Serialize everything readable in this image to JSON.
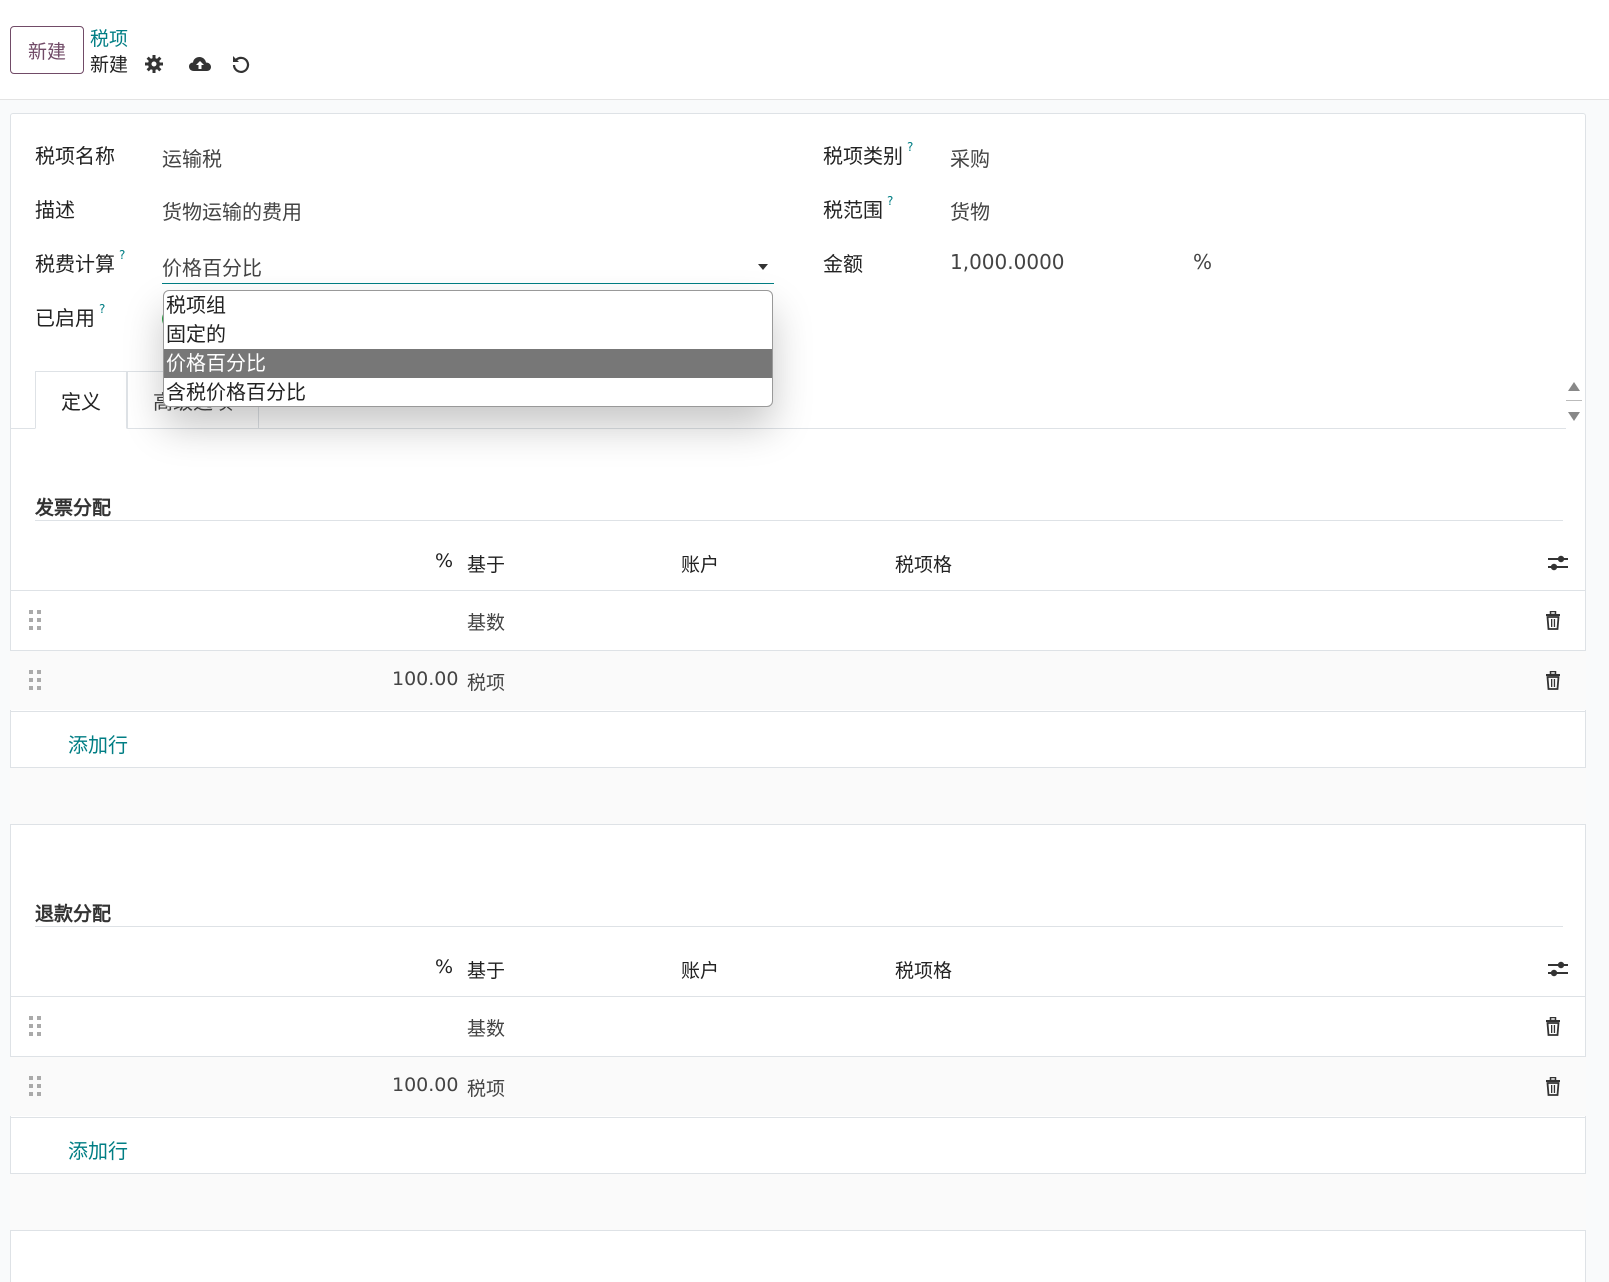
{
  "control_panel": {
    "new_button": "新建",
    "breadcrumb_parent": "税项",
    "breadcrumb_current": "新建"
  },
  "form": {
    "tax_name_label": "税项名称",
    "tax_name_value": "运输税",
    "description_label": "描述",
    "description_value": "货物运输的费用",
    "computation_label": "税费计算",
    "computation_value": "价格百分比",
    "active_label": "已启用",
    "tax_type_label": "税项类别",
    "tax_type_value": "采购",
    "tax_scope_label": "税范围",
    "tax_scope_value": "货物",
    "amount_label": "金额",
    "amount_value": "1,000.0000",
    "amount_unit": "%",
    "help_mark": "?"
  },
  "dropdown": {
    "options": [
      "税项组",
      "固定的",
      "价格百分比",
      "含税价格百分比"
    ],
    "selected": "价格百分比"
  },
  "tabs": {
    "definition": "定义",
    "advanced": "高级选项"
  },
  "invoice_section": {
    "title": "发票分配",
    "columns": {
      "percent": "%",
      "based_on": "基于",
      "account": "账户",
      "tax_grids": "税项格"
    },
    "rows": [
      {
        "percent": "",
        "based_on": "基数"
      },
      {
        "percent": "100.00",
        "based_on": "税项"
      }
    ],
    "add_line": "添加行"
  },
  "refund_section": {
    "title": "退款分配",
    "columns": {
      "percent": "%",
      "based_on": "基于",
      "account": "账户",
      "tax_grids": "税项格"
    },
    "rows": [
      {
        "percent": "",
        "based_on": "基数"
      },
      {
        "percent": "100.00",
        "based_on": "税项"
      }
    ],
    "add_line": "添加行"
  },
  "colors": {
    "brand": "#714b67",
    "link": "#017e84",
    "toggle_on": "#28a745"
  }
}
